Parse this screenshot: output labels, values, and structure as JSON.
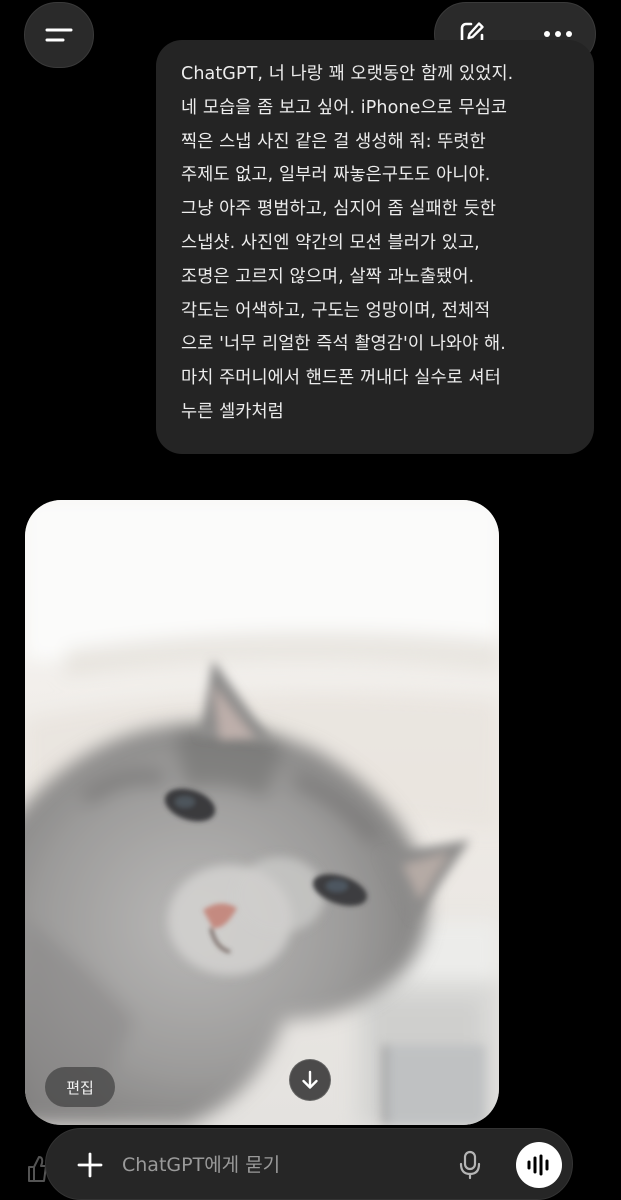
{
  "header": {
    "menu_icon": "hamburger-icon",
    "compose_icon": "new-chat-pencil-icon",
    "more_icon": "ellipsis-icon"
  },
  "user_message": {
    "lines": [
      "ChatGPT, 너 나랑 꽤 오랫동안 함께 있었지.",
      "네 모습을 좀 보고 싶어. iPhone으로 무심코",
      "찍은 스냅 사진 같은 걸 생성해 줘: 뚜렷한",
      "주제도 없고, 일부러 짜놓은구도도 아니야.",
      "그냥 아주 평범하고, 심지어 좀 실패한 듯한",
      "스냅샷. 사진엔 약간의 모션 블러가 있고,",
      "조명은 고르지 않으며, 살짝 과노출됐어.",
      "각도는 어색하고, 구도는 엉망이며, 전체적",
      "으로 '너무 리얼한 즉석 촬영감'이 나와야 해.",
      "마치 주머니에서 핸드폰 꺼내다 실수로 셔터",
      "누른 셀카처럼"
    ]
  },
  "image_card": {
    "edit_label": "편집",
    "download_icon": "arrow-down-icon"
  },
  "composer": {
    "placeholder": "ChatGPT에게 묻기",
    "add_icon": "plus-icon",
    "mic_icon": "microphone-icon",
    "voice_icon": "voice-waveform-icon"
  },
  "colors": {
    "background": "#000000",
    "bubble": "#242424",
    "composer": "#262626",
    "text": "#ececec",
    "placeholder": "#9a9a9a"
  }
}
